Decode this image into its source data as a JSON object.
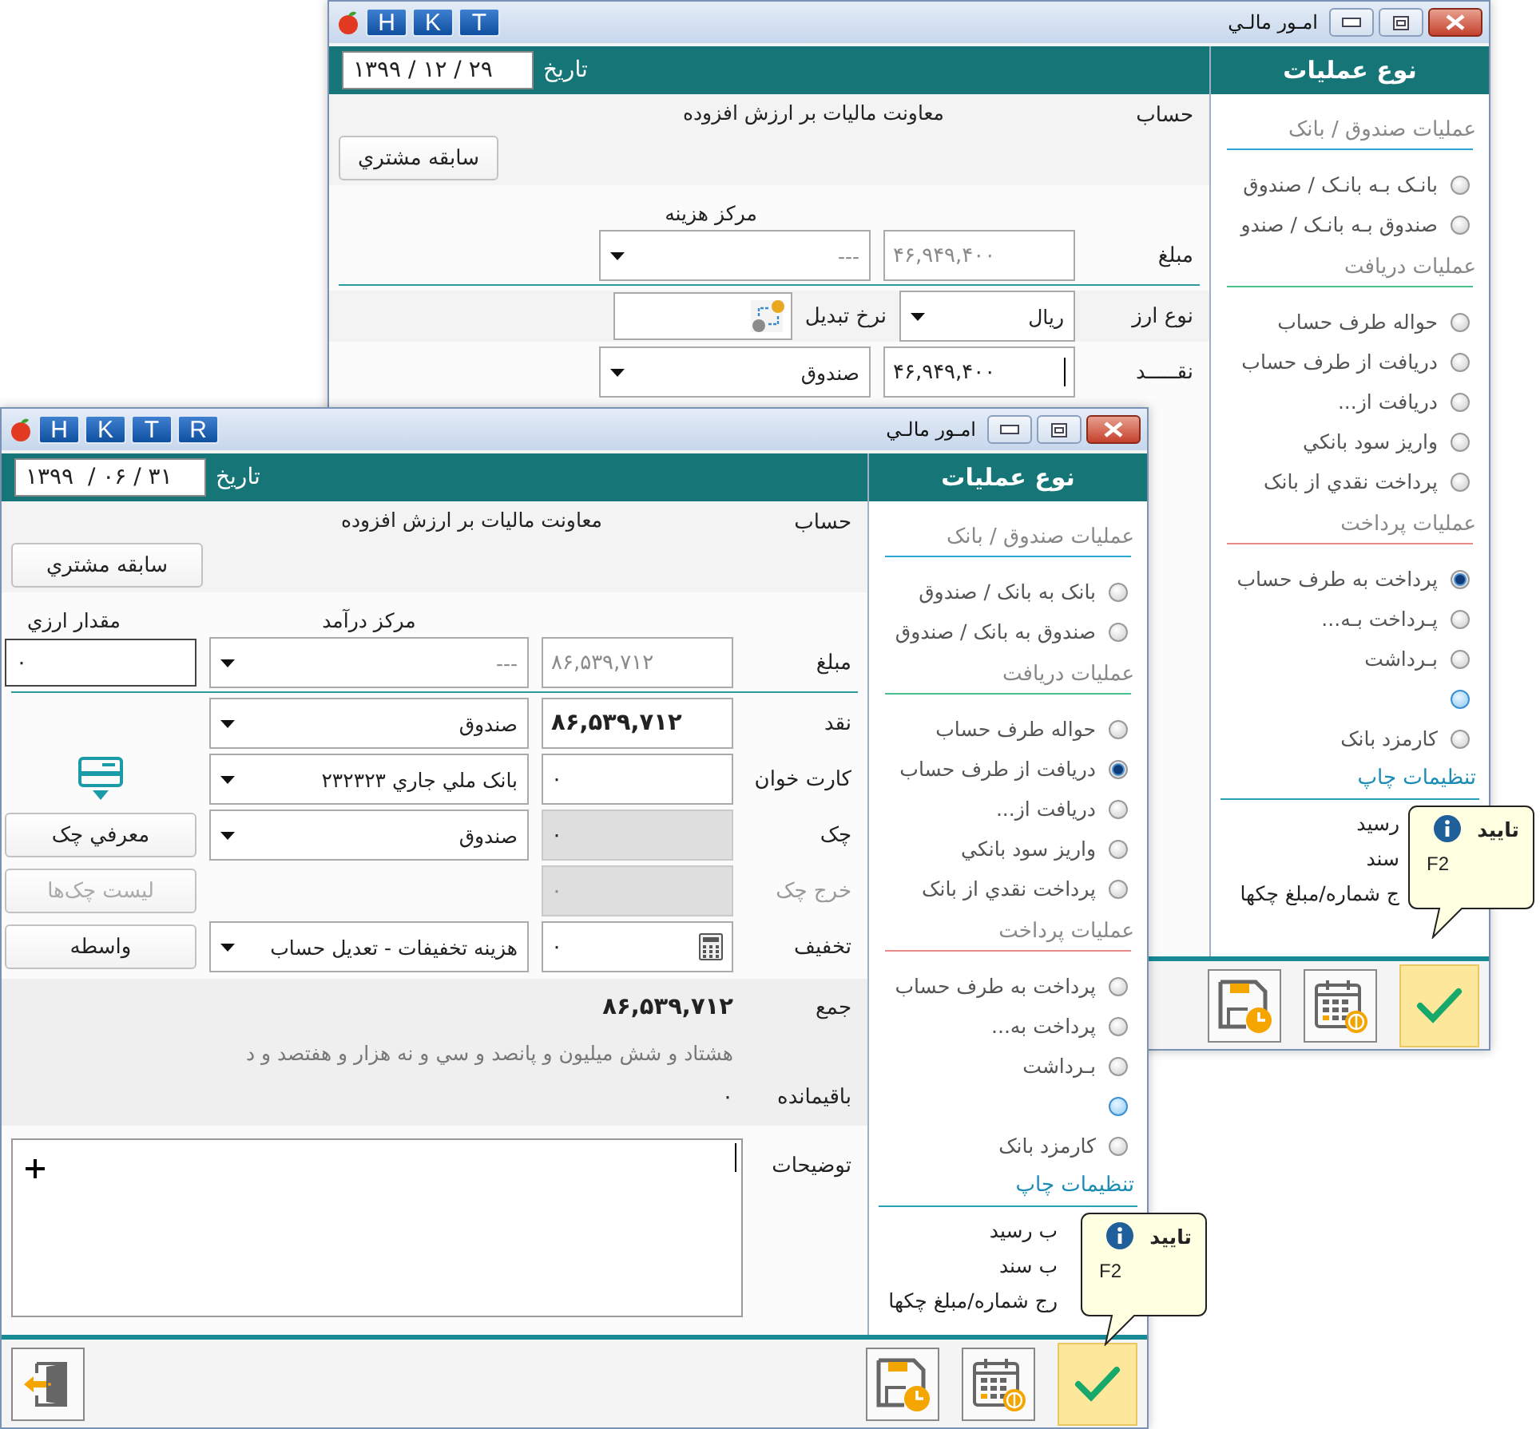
{
  "windows": [
    {
      "title": "امـور مالـي",
      "quick_buttons": [
        "T",
        "K",
        "H"
      ],
      "date_label": "تاريخ",
      "date": "۱۳۹۹ / ۱۲ / ۲۹",
      "rows": [
        {
          "kind": "account",
          "label": "حساب",
          "value": "معاونت ماليات بر ارزش افزوده",
          "button": "سابقه مشتري"
        },
        {
          "kind": "headings",
          "combo_heading": "مرکز هزينه"
        },
        {
          "kind": "entry",
          "label": "مبلغ",
          "label_muted": false,
          "field": {
            "kind": "plain",
            "value": "۴۶,۹۴۹,۴۰۰",
            "muted": true,
            "bold": false,
            "disabled": false,
            "focused": false
          },
          "combo": {
            "value": "---",
            "muted": true
          }
        },
        {
          "kind": "divider"
        },
        {
          "kind": "currency",
          "label": "نوع ارز",
          "currency": "ريال",
          "rate_label": "نرخ تبديل"
        },
        {
          "kind": "entry",
          "label": "نقـــــد",
          "label_muted": false,
          "field": {
            "kind": "plain",
            "value": "۴۶,۹۴۹,۴۰۰",
            "muted": false,
            "bold": false,
            "disabled": false,
            "focused": true
          },
          "combo": {
            "value": "صندوق",
            "muted": false
          }
        }
      ],
      "panel": {
        "title": "نوع عمليات",
        "groups": [
          {
            "title": "عمليات صندوق / بانک",
            "color": "#29a8d8",
            "items": [
              {
                "label": "بانـک بـه بانـک / صندوق",
                "selected": false,
                "highlighted": false
              },
              {
                "label": "صندوق بـه بانـک / صندو",
                "selected": false,
                "highlighted": false
              }
            ]
          },
          {
            "title": "عمليات دريافت",
            "color": "#4cc08c",
            "items": [
              {
                "label": "حواله طرف حساب",
                "selected": false,
                "highlighted": false
              },
              {
                "label": "دريافت از طرف حساب",
                "selected": false,
                "highlighted": false
              },
              {
                "label": "دريافت از...",
                "selected": false,
                "highlighted": false
              },
              {
                "label": "واريز سود بانکي",
                "selected": false,
                "highlighted": false
              },
              {
                "label": "پرداخت نقدي از بانک",
                "selected": false,
                "highlighted": false
              }
            ]
          },
          {
            "title": "عمليات پرداخت",
            "color": "#e88a8a",
            "items": [
              {
                "label": "پرداخت به طرف حساب",
                "selected": true,
                "highlighted": false
              },
              {
                "label": "پـرداخت بـه...",
                "selected": false,
                "highlighted": false
              },
              {
                "label": "بـرداشت",
                "selected": false,
                "highlighted": false
              },
              {
                "selected": false,
                "highlighted": true
              },
              {
                "label": "کارمزد بانک",
                "selected": false,
                "highlighted": false
              }
            ]
          }
        ],
        "print_title": "تنظيمات چاپ",
        "print_options": [
          "رسيد",
          "سند",
          "ج شماره/مبلغ چکها"
        ]
      },
      "tooltip": {
        "title": "تاييد",
        "key": "F2"
      },
      "toolbar": [
        {
          "kind": "save-schedule",
          "highlighted": false
        },
        {
          "kind": "calendar-payment",
          "highlighted": false
        },
        {
          "kind": "confirm",
          "highlighted": true
        }
      ]
    },
    {
      "title": "امـور مالـي",
      "quick_buttons": [
        "R",
        "T",
        "K",
        "H"
      ],
      "date_label": "تاريخ",
      "date": "۱۳۹۹  / ۰۶ / ۳۱",
      "rows": [
        {
          "kind": "account",
          "label": "حساب",
          "value": "معاونت ماليات بر ارزش افزوده",
          "button": "سابقه مشتري"
        },
        {
          "kind": "headings",
          "combo_heading": "مرکز درآمد",
          "extra_heading": "مقدار ارزي"
        },
        {
          "kind": "entry",
          "label": "مبلغ",
          "label_muted": false,
          "field": {
            "kind": "plain",
            "value": "۸۶,۵۳۹,۷۱۲",
            "muted": true,
            "bold": false,
            "disabled": false,
            "focused": false
          },
          "combo": {
            "value": "---",
            "muted": true
          },
          "extra": {
            "kind": "input",
            "value": "۰"
          }
        },
        {
          "kind": "divider"
        },
        {
          "kind": "entry",
          "label": "نقد",
          "label_muted": false,
          "field": {
            "kind": "plain",
            "value": "۸۶,۵۳۹,۷۱۲",
            "muted": false,
            "bold": true,
            "disabled": false,
            "focused": false
          },
          "combo": {
            "value": "صندوق",
            "muted": false
          }
        },
        {
          "kind": "entry",
          "label": "کارت خوان",
          "label_muted": false,
          "field": {
            "kind": "plain",
            "value": "۰",
            "muted": false,
            "bold": false,
            "disabled": false,
            "focused": false
          },
          "combo": {
            "value": "بانک ملي جاري ۲۳۲۳۲۳",
            "muted": false
          },
          "extra": {
            "kind": "card_reader"
          }
        },
        {
          "kind": "entry",
          "label": "چک",
          "label_muted": false,
          "field": {
            "kind": "plain",
            "value": "۰",
            "muted": false,
            "bold": false,
            "disabled": true,
            "focused": false
          },
          "combo": {
            "value": "صندوق",
            "muted": false
          },
          "extra": {
            "kind": "button",
            "label": "معرفي چک",
            "disabled": false
          }
        },
        {
          "kind": "entry",
          "label": "خرج چک",
          "label_muted": true,
          "field": {
            "kind": "plain",
            "value": "۰",
            "muted": true,
            "bold": false,
            "disabled": true,
            "focused": false
          },
          "extra": {
            "kind": "button",
            "label": "ليست چک‌ها",
            "disabled": true
          }
        },
        {
          "kind": "entry",
          "label": "تخفيف",
          "label_muted": false,
          "field": {
            "kind": "calc",
            "value": "۰",
            "muted": false,
            "bold": false,
            "disabled": false,
            "focused": false
          },
          "combo": {
            "value": "هزينه تخفيفات - تعديل حساب",
            "muted": false
          },
          "extra": {
            "kind": "button",
            "label": "واسطه",
            "disabled": false
          }
        }
      ],
      "summary": {
        "total_label": "جمع",
        "total": "۸۶,۵۳۹,۷۱۲",
        "words": "هشتاد و شش ميليون  و پانصد و سي و نه هزار  و هفتصد و د",
        "remainder_label": "باقيمانده",
        "remainder": "۰"
      },
      "notes": {
        "label": "توضيحات",
        "focused": true
      },
      "panel": {
        "title": "نوع عمليات",
        "groups": [
          {
            "title": "عمليات صندوق / بانک",
            "color": "#29a8d8",
            "items": [
              {
                "label": "بانک به بانک / صندوق",
                "selected": false,
                "highlighted": false
              },
              {
                "label": "صندوق به بانک / صندوق",
                "selected": false,
                "highlighted": false
              }
            ]
          },
          {
            "title": "عمليات دريافت",
            "color": "#4cc08c",
            "items": [
              {
                "label": "حواله طرف حساب",
                "selected": false,
                "highlighted": false
              },
              {
                "label": "دريافت از طرف حساب",
                "selected": true,
                "highlighted": false
              },
              {
                "label": "دريافت از...",
                "selected": false,
                "highlighted": false
              },
              {
                "label": "واريز سود بانکي",
                "selected": false,
                "highlighted": false
              },
              {
                "label": "پرداخت نقدي از بانک",
                "selected": false,
                "highlighted": false
              }
            ]
          },
          {
            "title": "عمليات پرداخت",
            "color": "#e88a8a",
            "items": [
              {
                "label": "پرداخت به طرف حساب",
                "selected": false,
                "highlighted": false
              },
              {
                "label": "پرداخت به...",
                "selected": false,
                "highlighted": false
              },
              {
                "label": "بـرداشت",
                "selected": false,
                "highlighted": false
              },
              {
                "selected": false,
                "highlighted": true
              },
              {
                "label": "کارمزد بانک",
                "selected": false,
                "highlighted": false
              }
            ]
          }
        ],
        "print_title": "تنظيمات چاپ",
        "print_options": [
          "ب رسيد",
          "ب سند",
          "رج شماره/مبلغ چکها"
        ]
      },
      "tooltip": {
        "title": "تاييد",
        "key": "F2"
      },
      "toolbar": [
        {
          "kind": "exit",
          "highlighted": false
        },
        {
          "kind": "save-schedule",
          "highlighted": false
        },
        {
          "kind": "calendar-payment",
          "highlighted": false
        },
        {
          "kind": "confirm",
          "highlighted": true
        }
      ]
    }
  ]
}
